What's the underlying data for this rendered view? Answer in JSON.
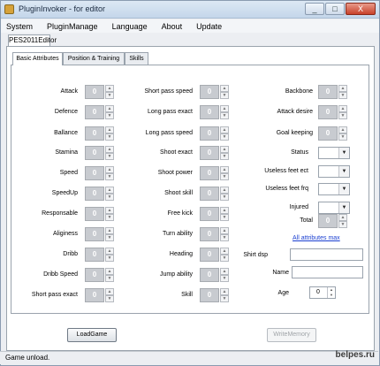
{
  "window": {
    "title": "PluginInvoker - for editor",
    "btn_min": "_",
    "btn_max": "□",
    "btn_close": "X"
  },
  "menu": [
    "System",
    "PluginManage",
    "Language",
    "About",
    "Update"
  ],
  "doc_tab": "PES2011Editor",
  "tabs": [
    "Basic Attributes",
    "Position & Training",
    "Skills"
  ],
  "col1": [
    {
      "label": "Attack",
      "value": "0"
    },
    {
      "label": "Defence",
      "value": "0"
    },
    {
      "label": "Ballance",
      "value": "0"
    },
    {
      "label": "Stamina",
      "value": "0"
    },
    {
      "label": "Speed",
      "value": "0"
    },
    {
      "label": "SpeedUp",
      "value": "0"
    },
    {
      "label": "Responsable",
      "value": "0"
    },
    {
      "label": "Aliginess",
      "value": "0"
    },
    {
      "label": "Dribb",
      "value": "0"
    },
    {
      "label": "Dribb Speed",
      "value": "0"
    },
    {
      "label": "Short pass exact",
      "value": "0"
    }
  ],
  "col2": [
    {
      "label": "Short pass speed",
      "value": "0"
    },
    {
      "label": "Long pass exact",
      "value": "0"
    },
    {
      "label": "Long pass speed",
      "value": "0"
    },
    {
      "label": "Shoot exact",
      "value": "0"
    },
    {
      "label": "Shoot power",
      "value": "0"
    },
    {
      "label": "Shoot skill",
      "value": "0"
    },
    {
      "label": "Free kick",
      "value": "0"
    },
    {
      "label": "Turn ability",
      "value": "0"
    },
    {
      "label": "Heading",
      "value": "0"
    },
    {
      "label": "Jump ability",
      "value": "0"
    },
    {
      "label": "Skill",
      "value": "0"
    }
  ],
  "col3_spins": [
    {
      "label": "Backbone",
      "value": "0"
    },
    {
      "label": "Attack desire",
      "value": "0"
    },
    {
      "label": "Goal keeping",
      "value": "0"
    }
  ],
  "col3_combos": [
    "Status",
    "Useless feet ect",
    "Useless feet frq",
    "Injured"
  ],
  "total": {
    "label": "Total",
    "value": "0"
  },
  "all_max_link": "All attributes max",
  "shirt_dsp_label": "Shirt dsp",
  "name_label": "Name",
  "age": {
    "label": "Age",
    "value": "0"
  },
  "buttons": {
    "load": "LoadGame",
    "write": "WriteMemory"
  },
  "status": "Game unload.",
  "watermark": "belpes.ru"
}
